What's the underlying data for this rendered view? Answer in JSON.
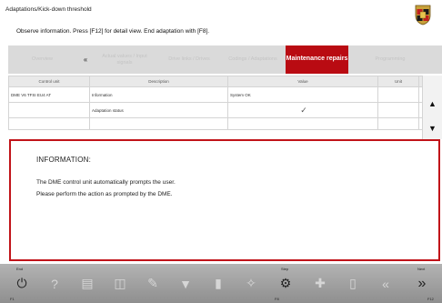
{
  "header": {
    "title": "Adaptations/Kick-down threshold",
    "instruction": "Observe information. Press [F12] for detail view. End adaptation with [F8]."
  },
  "tabs": [
    {
      "label": "Overview",
      "active": false
    },
    {
      "label": "Actual values / Input signals",
      "active": false
    },
    {
      "label": "Drive links / Drives",
      "active": false
    },
    {
      "label": "Codings / Adaptations",
      "active": false
    },
    {
      "label": "Maintenance repairs",
      "active": true
    },
    {
      "label": "Programming",
      "active": false
    }
  ],
  "tab_scroll_left": "«",
  "table": {
    "headers": [
      "Control unit",
      "Description",
      "Value",
      "Unit"
    ],
    "rows": [
      {
        "control_unit": "DME V6 TFSI EU4 AT",
        "description": "Information",
        "value": "System OK",
        "unit": ""
      },
      {
        "control_unit": "",
        "description": "Adaptation status",
        "value": "",
        "unit": ""
      }
    ],
    "status_icon": "checkmark-icon"
  },
  "scroll": {
    "up": "▲",
    "down": "▼"
  },
  "info": {
    "heading": "INFORMATION:",
    "line1": "The DME control unit automatically prompts the user.",
    "line2": "Please perform the action as prompted by the DME."
  },
  "toolbar": {
    "end_label": "End",
    "end_key": "F1",
    "step_label": "Step",
    "step_key": "F8",
    "next_label": "Next",
    "next_key": "F12"
  },
  "colors": {
    "accent": "#b90b12",
    "tabbar": "#dadada",
    "toolbar": "#a3a3a3"
  }
}
